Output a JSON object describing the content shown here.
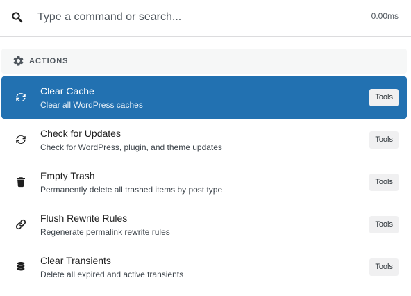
{
  "search": {
    "placeholder": "Type a command or search...",
    "value": "",
    "timing": "0.00ms",
    "icon": "search-icon"
  },
  "group": {
    "title": "ACTIONS",
    "icon": "gear-icon"
  },
  "colors": {
    "accent": "#2271b1",
    "badge_bg": "#f0f0f1",
    "header_bg": "#f6f7f7"
  },
  "items": [
    {
      "title": "Clear Cache",
      "description": "Clear all WordPress caches",
      "badge": "Tools",
      "icon": "refresh-icon",
      "selected": true
    },
    {
      "title": "Check for Updates",
      "description": "Check for WordPress, plugin, and theme updates",
      "badge": "Tools",
      "icon": "refresh-icon",
      "selected": false
    },
    {
      "title": "Empty Trash",
      "description": "Permanently delete all trashed items by post type",
      "badge": "Tools",
      "icon": "trash-icon",
      "selected": false
    },
    {
      "title": "Flush Rewrite Rules",
      "description": "Regenerate permalink rewrite rules",
      "badge": "Tools",
      "icon": "link-icon",
      "selected": false
    },
    {
      "title": "Clear Transients",
      "description": "Delete all expired and active transients",
      "badge": "Tools",
      "icon": "database-icon",
      "selected": false
    }
  ]
}
